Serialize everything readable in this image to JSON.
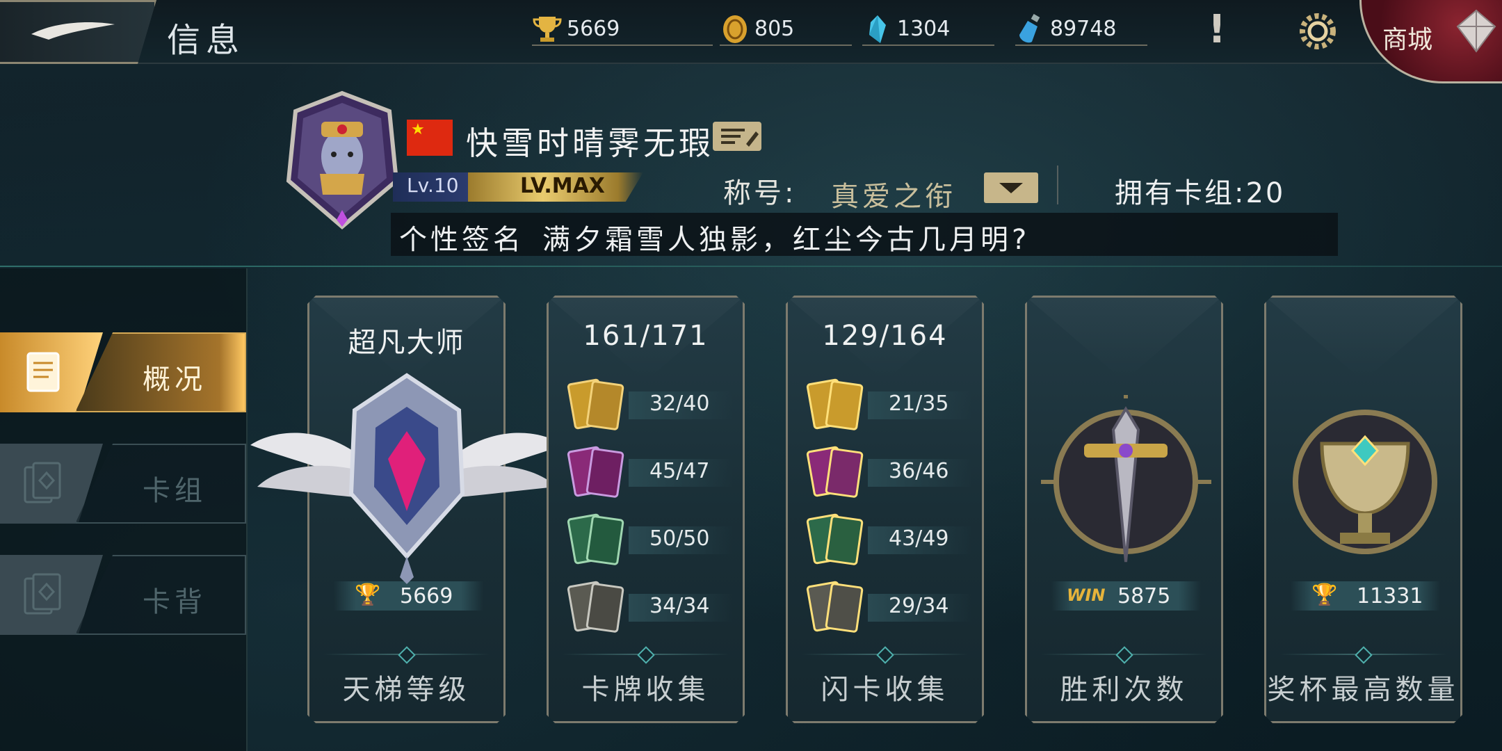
{
  "header": {
    "title": "信息",
    "resources": [
      {
        "name": "trophy-icon",
        "value": "5669"
      },
      {
        "name": "gold-coin-icon",
        "value": "805"
      },
      {
        "name": "crystal-icon",
        "value": "1304"
      },
      {
        "name": "potion-icon",
        "value": "89748"
      }
    ],
    "shop_label": "商城"
  },
  "profile": {
    "player_name": "快雪时晴霁无瑕",
    "level": "Lv.10",
    "level_max": "LV.MAX",
    "title_label": "称号:",
    "title_value": "真爱之衔",
    "decks_owned": "拥有卡组:20",
    "signature_label": "个性签名",
    "signature_text": "满夕霜雪人独影，红尘今古几月明?"
  },
  "sidebar": {
    "items": [
      {
        "label": "概况",
        "active": true
      },
      {
        "label": "卡组",
        "active": false
      },
      {
        "label": "卡背",
        "active": false
      }
    ]
  },
  "cards": {
    "ladder": {
      "title": "超凡大师",
      "value": "5669",
      "footer": "天梯等级"
    },
    "collection": {
      "title": "161/171",
      "rows": [
        "32/40",
        "45/47",
        "50/50",
        "34/34"
      ],
      "footer": "卡牌收集"
    },
    "flash": {
      "title": "129/164",
      "rows": [
        "21/35",
        "36/46",
        "43/49",
        "29/34"
      ],
      "footer": "闪卡收集"
    },
    "wins": {
      "badge": "WIN",
      "value": "5875",
      "footer": "胜利次数"
    },
    "trophies": {
      "value": "11331",
      "footer": "奖杯最高数量"
    }
  },
  "colors": {
    "accent_gold": "#e3b442",
    "card_border": "#7d7b6e",
    "rarity": [
      "#c99b2c",
      "#8a2a78",
      "#2c6a4a",
      "#5a5a52"
    ]
  }
}
